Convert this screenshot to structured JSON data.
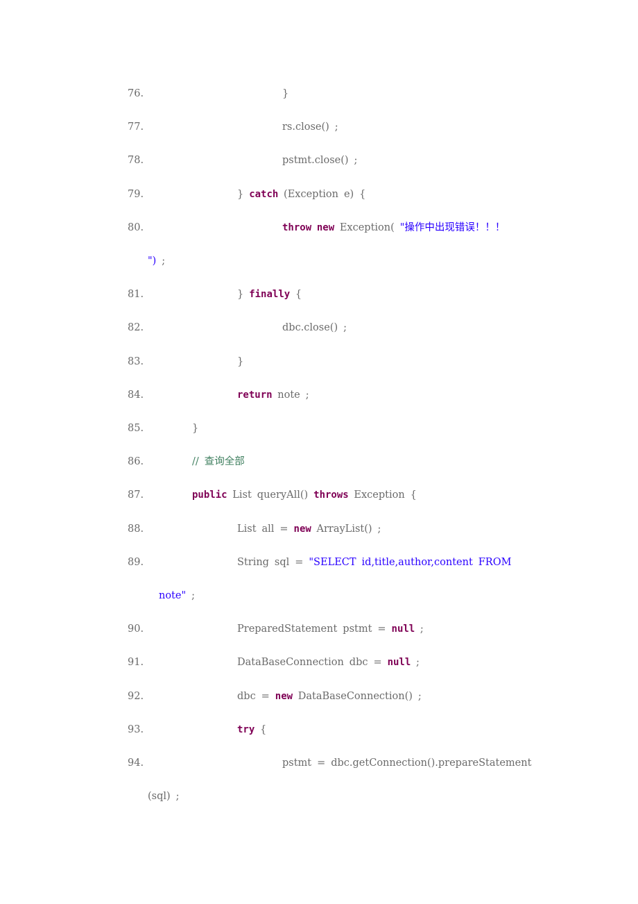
{
  "colors": {
    "keyword": "#7f0055",
    "string": "#2a00ff",
    "comment": "#3f7f5f",
    "text": "#6a6a6a",
    "background": "#ffffff"
  },
  "lines": [
    {
      "num": "76.",
      "indent": 3,
      "tokens": [
        {
          "t": "txt",
          "v": "}"
        }
      ]
    },
    {
      "num": "77.",
      "indent": 3,
      "tokens": [
        {
          "t": "txt",
          "v": "rs.close()"
        },
        {
          "t": "txt",
          "v": ";"
        }
      ]
    },
    {
      "num": "78.",
      "indent": 3,
      "tokens": [
        {
          "t": "txt",
          "v": "pstmt.close()"
        },
        {
          "t": "txt",
          "v": ";"
        }
      ]
    },
    {
      "num": "79.",
      "indent": 2,
      "tokens": [
        {
          "t": "txt",
          "v": "}"
        },
        {
          "t": "kw",
          "v": "catch"
        },
        {
          "t": "txt",
          "v": "(Exception"
        },
        {
          "t": "txt",
          "v": "e)"
        },
        {
          "t": "txt",
          "v": "{"
        }
      ]
    },
    {
      "num": "80.",
      "indent": 3,
      "tokens": [
        {
          "t": "kw",
          "v": "throw"
        },
        {
          "t": "kw",
          "v": "new"
        },
        {
          "t": "txt",
          "v": "Exception("
        },
        {
          "t": "str",
          "v": "\"操作中出现错误！！！"
        }
      ]
    },
    {
      "num": "",
      "indent": "wrap1",
      "tokens": [
        {
          "t": "str",
          "v": "\")"
        },
        {
          "t": "txt",
          "v": ";"
        }
      ]
    },
    {
      "num": "81.",
      "indent": 2,
      "tokens": [
        {
          "t": "txt",
          "v": "}"
        },
        {
          "t": "kw",
          "v": "finally"
        },
        {
          "t": "txt",
          "v": "{"
        }
      ]
    },
    {
      "num": "82.",
      "indent": 3,
      "tokens": [
        {
          "t": "txt",
          "v": "dbc.close()"
        },
        {
          "t": "txt",
          "v": ";"
        }
      ]
    },
    {
      "num": "83.",
      "indent": 2,
      "tokens": [
        {
          "t": "txt",
          "v": "}"
        }
      ]
    },
    {
      "num": "84.",
      "indent": 2,
      "tokens": [
        {
          "t": "kw",
          "v": "return"
        },
        {
          "t": "txt",
          "v": "note"
        },
        {
          "t": "txt",
          "v": ";"
        }
      ]
    },
    {
      "num": "85.",
      "indent": 1,
      "tokens": [
        {
          "t": "txt",
          "v": "}"
        }
      ]
    },
    {
      "num": "86.",
      "indent": 1,
      "tokens": [
        {
          "t": "cmt",
          "v": "//"
        },
        {
          "t": "cmt",
          "v": "查询全部"
        }
      ]
    },
    {
      "num": "87.",
      "indent": 1,
      "tokens": [
        {
          "t": "kw",
          "v": "public"
        },
        {
          "t": "txt",
          "v": "List"
        },
        {
          "t": "txt",
          "v": "queryAll()"
        },
        {
          "t": "kw",
          "v": "throws"
        },
        {
          "t": "txt",
          "v": "Exception"
        },
        {
          "t": "txt",
          "v": "{"
        }
      ]
    },
    {
      "num": "88.",
      "indent": 2,
      "tokens": [
        {
          "t": "txt",
          "v": "List"
        },
        {
          "t": "txt",
          "v": "all"
        },
        {
          "t": "txt",
          "v": "="
        },
        {
          "t": "kw",
          "v": "new"
        },
        {
          "t": "txt",
          "v": "ArrayList()"
        },
        {
          "t": "txt",
          "v": ";"
        }
      ]
    },
    {
      "num": "89.",
      "indent": 2,
      "tokens": [
        {
          "t": "txt",
          "v": "String"
        },
        {
          "t": "txt",
          "v": "sql"
        },
        {
          "t": "txt",
          "v": "="
        },
        {
          "t": "str",
          "v": "\"SELECT"
        },
        {
          "t": "str",
          "v": "id,title,author,content"
        },
        {
          "t": "str",
          "v": "FROM"
        }
      ]
    },
    {
      "num": "",
      "indent": "wrap2",
      "tokens": [
        {
          "t": "str",
          "v": "note\""
        },
        {
          "t": "txt",
          "v": ";"
        }
      ]
    },
    {
      "num": "90.",
      "indent": 2,
      "tokens": [
        {
          "t": "txt",
          "v": "PreparedStatement"
        },
        {
          "t": "txt",
          "v": "pstmt"
        },
        {
          "t": "txt",
          "v": "="
        },
        {
          "t": "kw",
          "v": "null"
        },
        {
          "t": "txt",
          "v": ";"
        }
      ]
    },
    {
      "num": "91.",
      "indent": 2,
      "tokens": [
        {
          "t": "txt",
          "v": "DataBaseConnection"
        },
        {
          "t": "txt",
          "v": "dbc"
        },
        {
          "t": "txt",
          "v": "="
        },
        {
          "t": "kw",
          "v": "null"
        },
        {
          "t": "txt",
          "v": ";"
        }
      ]
    },
    {
      "num": "92.",
      "indent": 2,
      "tokens": [
        {
          "t": "txt",
          "v": "dbc"
        },
        {
          "t": "txt",
          "v": "="
        },
        {
          "t": "kw",
          "v": "new"
        },
        {
          "t": "txt",
          "v": "DataBaseConnection()"
        },
        {
          "t": "txt",
          "v": ";"
        }
      ]
    },
    {
      "num": "93.",
      "indent": 2,
      "tokens": [
        {
          "t": "kw",
          "v": "try"
        },
        {
          "t": "txt",
          "v": "{"
        }
      ]
    },
    {
      "num": "94.",
      "indent": 3,
      "tokens": [
        {
          "t": "txt",
          "v": "pstmt"
        },
        {
          "t": "txt",
          "v": "="
        },
        {
          "t": "txt",
          "v": "dbc.getConnection().prepareStatement"
        }
      ]
    },
    {
      "num": "",
      "indent": "wrap1",
      "tokens": [
        {
          "t": "txt",
          "v": "(sql)"
        },
        {
          "t": "txt",
          "v": ";"
        }
      ]
    }
  ]
}
